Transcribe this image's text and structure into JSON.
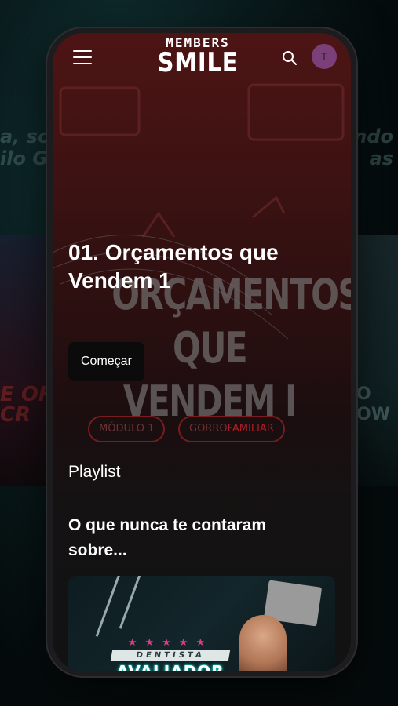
{
  "background": {
    "left_text": "a, soi\nilo Go",
    "right_text": "ando\nas",
    "lower_left": "E OF\nCR",
    "lower_right": "O\nOW"
  },
  "header": {
    "logo_top": "MEMBERS",
    "logo_main": "SMILE",
    "avatar_initial": "T",
    "icons": [
      "menu-icon",
      "search-icon"
    ]
  },
  "hero": {
    "title": "01. Orçamentos que Vendem 1",
    "art_title": "ORÇAMENTOS QUE VENDEM I",
    "chips": [
      "MÓDULO 1",
      "GORRO",
      "FAMILIAR"
    ],
    "start_label": "Começar"
  },
  "playlist_label": "Playlist",
  "section_title": "O que nunca te contaram sobre...",
  "card": {
    "small_label": "DENTISTA",
    "big_label": "AVALIADOR"
  },
  "colors": {
    "accent": "#7b3f7a",
    "hero_bg": "#4d1414",
    "neon": "#19d0c8",
    "star": "#e13b87"
  }
}
